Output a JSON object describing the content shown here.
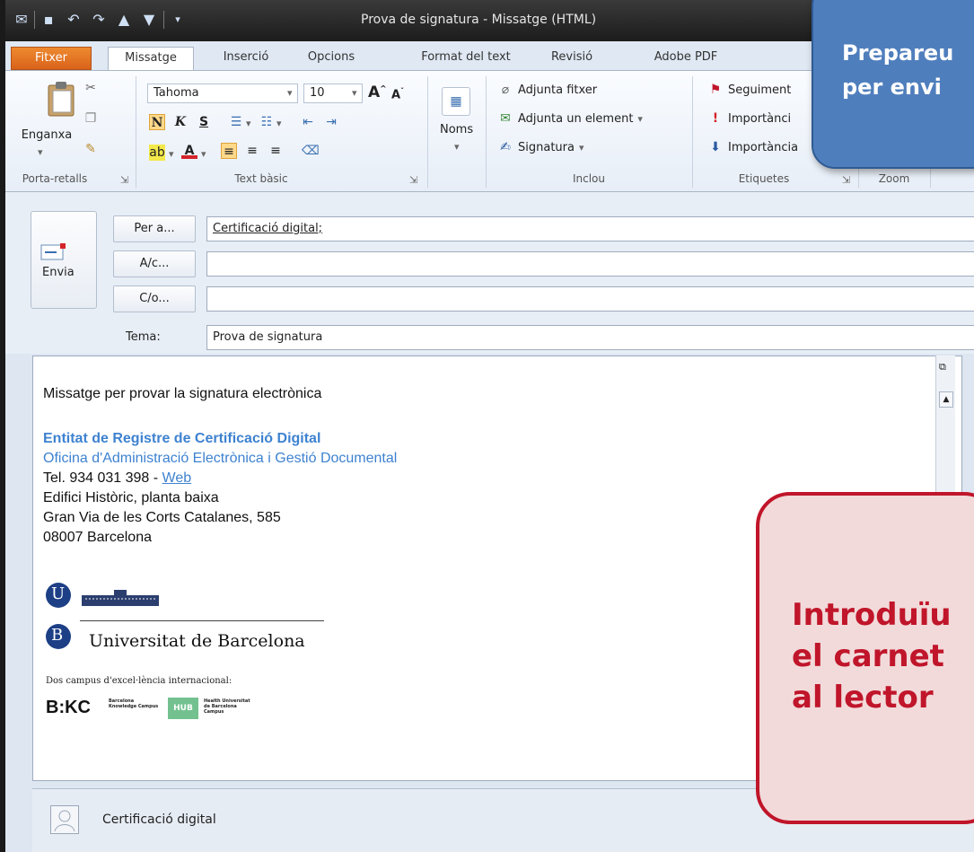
{
  "window": {
    "title": "Prova de signatura  -  Missatge (HTML)"
  },
  "tabs": [
    {
      "label": "Fitxer"
    },
    {
      "label": "Missatge"
    },
    {
      "label": "Inserció"
    },
    {
      "label": "Opcions"
    },
    {
      "label": "Format del text"
    },
    {
      "label": "Revisió"
    },
    {
      "label": "Adobe PDF"
    }
  ],
  "ribbon": {
    "clipboard": {
      "paste_label": "Enganxa",
      "group_label": "Porta-retalls"
    },
    "basic_text": {
      "font_name": "Tahoma",
      "font_size": "10",
      "bold": "N",
      "italic": "K",
      "underline": "S",
      "group_label": "Text bàsic"
    },
    "names": {
      "label": "Noms"
    },
    "include": {
      "attach_file": "Adjunta fitxer",
      "attach_item": "Adjunta un element",
      "signature": "Signatura",
      "group_label": "Inclou"
    },
    "tags": {
      "followup": "Seguiment",
      "importance_high": "Importànci",
      "importance_low": "Importància",
      "group_label": "Etiquetes"
    },
    "zoom": {
      "group_label": "Zoom"
    }
  },
  "compose": {
    "send_label": "Envia",
    "to_button": "Per a...",
    "cc_button": "A/c...",
    "bcc_button": "C/o...",
    "to_value": "Certificació digital;",
    "cc_value": "",
    "bcc_value": "",
    "subject_label": "Tema:",
    "subject_value": "Prova de signatura"
  },
  "body": {
    "line1": "Missatge per provar la signatura electrònica",
    "sig_title": "Entitat de Registre de Certificació Digital",
    "sig_office": "Oficina d'Administració Electrònica i Gestió Documental",
    "tel": "Tel. 934 031 398 - ",
    "web_link": "Web",
    "address1": "Edifici Històric, planta baixa",
    "address2": "Gran Via de les Corts Catalanes, 585",
    "address3": "08007 Barcelona",
    "logo_u": "U",
    "logo_b": "B",
    "university": "Universitat de Barcelona",
    "campus_line": "Dos campus d'excel·lència internacional:",
    "bkc": "B:KC",
    "bkc_sub": "Barcelona Knowledge Campus",
    "hub": "HUB",
    "hub_sub": "Health Universitat de Barcelona Campus"
  },
  "people_pane": {
    "name": "Certificació digital"
  },
  "callouts": {
    "blue_line1": "Prepareu",
    "blue_line2": "per envi",
    "red_line1": "Introduïu",
    "red_line2": "el carnet",
    "red_line3": "al lector"
  },
  "colors": {
    "accent_orange": "#d9631a",
    "link_blue": "#3e82d0",
    "callout_red": "#c0152a",
    "callout_blue": "#4f7ebd"
  }
}
